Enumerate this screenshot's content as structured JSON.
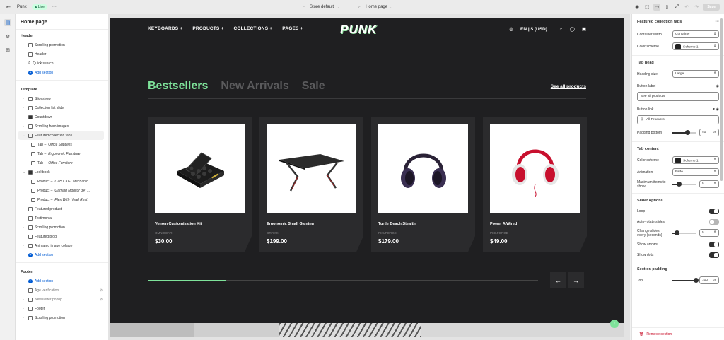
{
  "topbar": {
    "store_name": "Punk",
    "live_badge": "Live",
    "more": "···",
    "theme_select": "Store default",
    "page_select": "Home page",
    "save_label": "Save"
  },
  "left_panel": {
    "title": "Home page",
    "header_group": "Header",
    "header_items": [
      {
        "label": "Scrolling promotion",
        "icon": "section-icon"
      },
      {
        "label": "Header",
        "icon": "section-icon"
      },
      {
        "label": "Quick search",
        "icon": "search-icon"
      }
    ],
    "add_section": "Add section",
    "template_group": "Template",
    "template_items": [
      {
        "label": "Slideshow"
      },
      {
        "label": "Collection list slider"
      },
      {
        "label": "Countdown"
      },
      {
        "label": "Scrolling hero images"
      },
      {
        "label": "Featured collection tabs"
      }
    ],
    "featured_tabs": [
      {
        "prefix": "Tab –",
        "name": "Office Supplies"
      },
      {
        "prefix": "Tab –",
        "name": "Ergonomic Furniture"
      },
      {
        "prefix": "Tab –",
        "name": "Office Furniture"
      }
    ],
    "lookbook": "Lookbook",
    "lookbook_items": [
      {
        "prefix": "Product –",
        "name": "DZH CK67 Mechanic..."
      },
      {
        "prefix": "Product –",
        "name": "Gaming Monitor 34\" ..."
      },
      {
        "prefix": "Product –",
        "name": "Plex With Head Rest"
      }
    ],
    "template_items2": [
      {
        "label": "Featured product"
      },
      {
        "label": "Testimonial"
      },
      {
        "label": "Scrolling promotion"
      },
      {
        "label": "Featured blog"
      },
      {
        "label": "Animated image collage"
      }
    ],
    "footer_group": "Footer",
    "footer_items": [
      {
        "label": "Age verification"
      },
      {
        "label": "Newsletter popup"
      },
      {
        "label": "Footer"
      },
      {
        "label": "Scrolling promotion"
      }
    ]
  },
  "store": {
    "nav": [
      "KEYBOARDS",
      "PRODUCTS",
      "COLLECTIONS",
      "PAGES"
    ],
    "logo": "PUNK",
    "locale": "EN | $ (USD)",
    "tabs": [
      "Bestsellers",
      "New Arrivals",
      "Sale"
    ],
    "see_all": "See all products",
    "products": [
      {
        "name": "Venom Customisation Kit",
        "brand": "OMNIGEAR",
        "price": "$30.00",
        "image": "case-kit"
      },
      {
        "name": "Ergonomic Small Gaming",
        "brand": "GRAVIX",
        "price": "$199.00",
        "image": "desk"
      },
      {
        "name": "Turtle Beach Stealth",
        "brand": "PIXLFORGE",
        "price": "$179.00",
        "image": "headphones-dark"
      },
      {
        "name": "Power A Wired",
        "brand": "PIXLFORGE",
        "price": "$49.00",
        "image": "headphones-red"
      }
    ],
    "progress": 0.2,
    "accent": "#7ee29a"
  },
  "right_panel": {
    "title": "Featured collection tabs",
    "container_width_label": "Container width",
    "container_width_value": "Container",
    "color_scheme_label": "Color scheme",
    "color_scheme_value": "Scheme 1",
    "tab_head": "Tab head",
    "heading_size_label": "Heading size",
    "heading_size_value": "Large",
    "button_label_label": "Button label",
    "button_label_value": "See all products",
    "button_link_label": "Button link",
    "button_link_value": "All Products",
    "padding_bottom_label": "Padding bottom",
    "padding_bottom_value": "40",
    "padding_bottom_unit": "px",
    "tab_content": "Tab content",
    "color_scheme2_label": "Color scheme",
    "color_scheme2_value": "Scheme 1",
    "animation_label": "Animation",
    "animation_value": "Fade",
    "max_items_label": "Maximum items to show",
    "max_items_value": "5",
    "slider_options": "Slider options",
    "loop_label": "Loop",
    "autorotate_label": "Auto-rotate slides",
    "change_slides_label": "Change slides every (seconds)",
    "change_slides_value": "5",
    "show_arrows_label": "Show arrows",
    "show_dots_label": "Show dots",
    "section_padding": "Section padding",
    "top_label": "Top",
    "top_value": "100",
    "top_unit": "px",
    "remove_label": "Remove section"
  }
}
